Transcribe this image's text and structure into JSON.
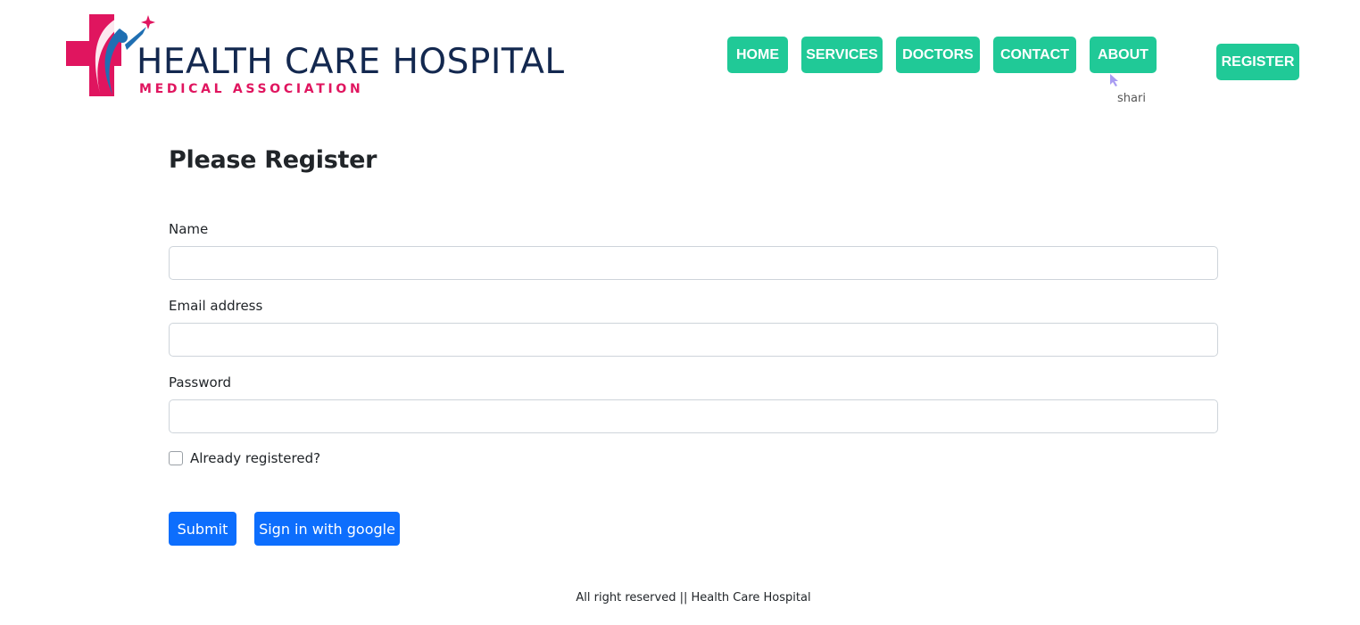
{
  "brand": {
    "title": "HEALTH CARE HOSPITAL",
    "subtitle": "MEDICAL ASSOCIATION",
    "colors": {
      "navy": "#13284f",
      "pink": "#e0155f",
      "blue": "#1f6fb2"
    }
  },
  "nav": {
    "items": [
      {
        "label": "HOME"
      },
      {
        "label": "SERVICES"
      },
      {
        "label": "DOCTORS"
      },
      {
        "label": "CONTACT"
      },
      {
        "label": "ABOUT"
      }
    ],
    "register_label": "REGISTER",
    "accent": "#20c997"
  },
  "cursor": {
    "label": "shari"
  },
  "form": {
    "title": "Please Register",
    "name_label": "Name",
    "name_value": "",
    "email_label": "Email address",
    "email_value": "",
    "password_label": "Password",
    "password_value": "",
    "checkbox_label": "Already registered?",
    "checkbox_checked": false,
    "submit_label": "Submit",
    "google_label": "Sign in with google",
    "button_color": "#0d6efd"
  },
  "footer": {
    "text": "All right reserved || Health Care Hospital"
  }
}
